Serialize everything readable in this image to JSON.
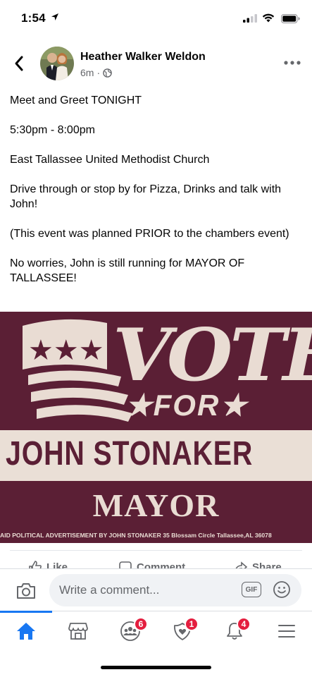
{
  "status_bar": {
    "time": "1:54"
  },
  "post": {
    "author": "Heather Walker Weldon",
    "time_ago": "6m",
    "meta_separator": "·",
    "paragraphs": [
      "Meet and Greet TONIGHT",
      "5:30pm - 8:00pm",
      "East Tallassee United Methodist Church",
      "Drive through or stop by for Pizza, Drinks and talk with John!",
      "(This event was planned PRIOR to the chambers event)",
      "No worries, John is still running for MAYOR OF TALLASSEE!"
    ]
  },
  "sign": {
    "vote": "VOTE",
    "for": "★FOR★",
    "name": "JOHN STONAKER",
    "title": "MAYOR",
    "disclaimer": "AID POLITICAL ADVERTISEMENT BY JOHN STONAKER 35 Blossam Circle Tallassee,AL 36078"
  },
  "actions": {
    "like": "Like",
    "comment": "Comment",
    "share": "Share"
  },
  "comment_bar": {
    "placeholder": "Write a comment...",
    "gif_label": "GIF"
  },
  "tab_bar": {
    "groups_badge": "6",
    "dating_badge": "1",
    "notifications_badge": "4"
  },
  "colors": {
    "accent": "#1877f2",
    "badge": "#e41e3f",
    "sign_maroon": "#5b1f35",
    "sign_cream": "#eadfd6"
  }
}
